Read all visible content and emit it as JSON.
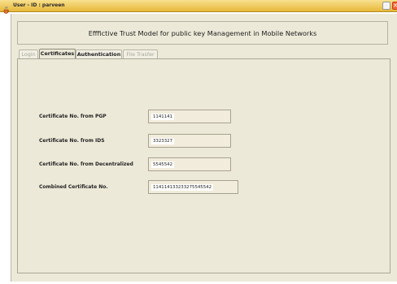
{
  "window": {
    "title": "User - ID : parveen",
    "close_glyph": "✕"
  },
  "header": {
    "title": "Efffictive Trust Model for public key Management in  Mobile Networks"
  },
  "tabs": [
    {
      "label": "Login",
      "state": "disabled"
    },
    {
      "label": "Certificates",
      "state": "selected"
    },
    {
      "label": "Authentication",
      "state": "enabled"
    },
    {
      "label": "File Trasfer",
      "state": "disabled"
    }
  ],
  "fields": [
    {
      "label": "Certificate No. from PGP",
      "value": "1141141"
    },
    {
      "label": "Certificate No. from IDS",
      "value": "3323327"
    },
    {
      "label": "Certificate No. from Decentralized",
      "value": "5545542"
    },
    {
      "label": "Combined Certificate No.",
      "value": "114114133233275545542"
    }
  ],
  "colors": {
    "titlebar": "#e8b838",
    "panel_background": "#ece9d8",
    "field_background": "#f2ecdc"
  },
  "icons": {
    "app": "java-cup-icon",
    "minimize": "minimize-icon",
    "close": "close-icon"
  }
}
